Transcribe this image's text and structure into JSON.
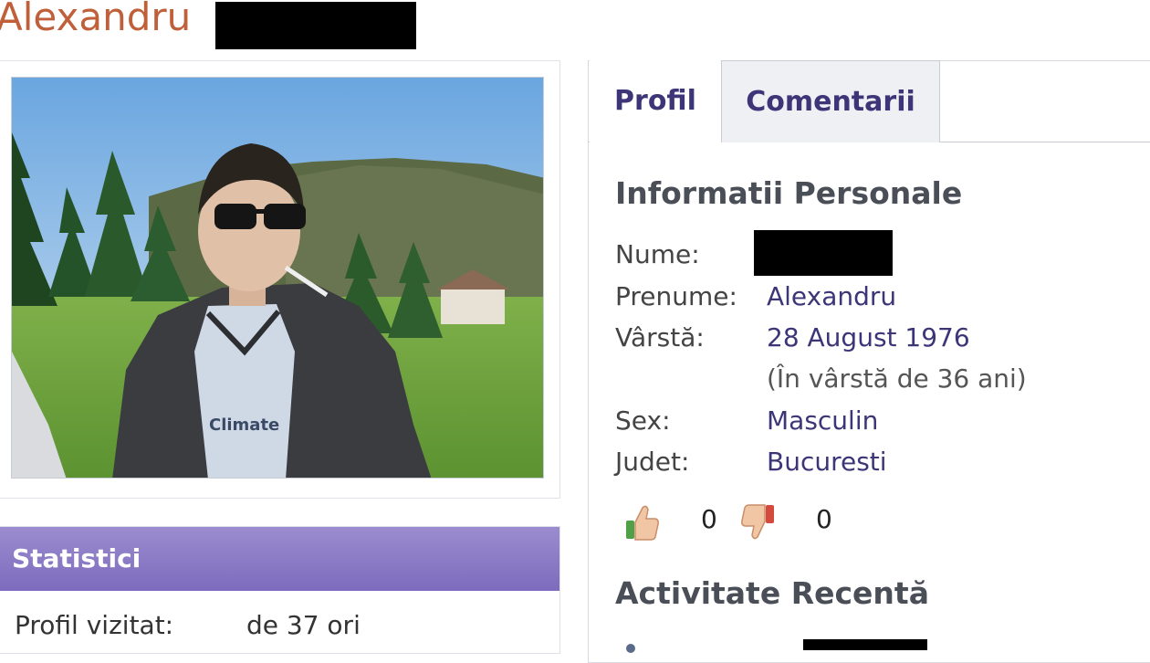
{
  "profile": {
    "first_name": "Alexandru"
  },
  "tabs": [
    {
      "label": "Profil",
      "active": true
    },
    {
      "label": "Comentarii",
      "active": false
    }
  ],
  "personal_info": {
    "title": "Informatii Personale",
    "fields": {
      "nume_label": "Nume:",
      "prenume_label": "Prenume:",
      "prenume_value": "Alexandru",
      "varsta_label": "Vârstă:",
      "varsta_value": "28 August 1976",
      "varsta_sub": "(În vârstă de 36 ani)",
      "sex_label": "Sex:",
      "sex_value": "Masculin",
      "judet_label": "Judet:",
      "judet_value": "Bucuresti"
    }
  },
  "votes": {
    "likes": "0",
    "dislikes": "0"
  },
  "activity": {
    "title": "Activitate Recentă"
  },
  "stats": {
    "title": "Statistici",
    "visits_label": "Profil vizitat:",
    "visits_value": "de 37 ori"
  },
  "colors": {
    "name_orange": "#c0603a",
    "link_purple": "#3c3577",
    "stats_header": "#8b7bc6"
  },
  "icons": [
    "thumbs-up-icon",
    "thumbs-down-icon",
    "user-icon"
  ]
}
